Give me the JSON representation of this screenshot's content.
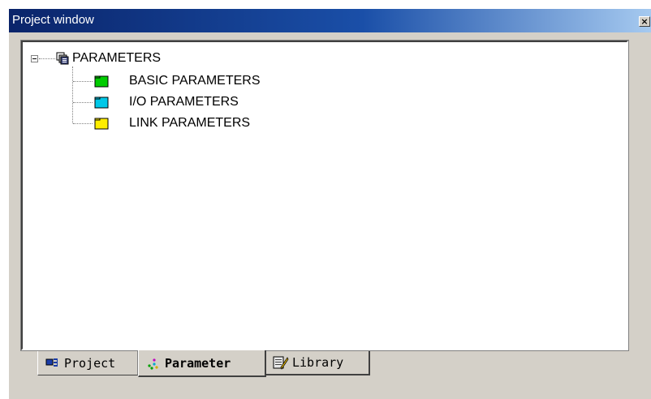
{
  "window": {
    "title": "Project window",
    "close_label": "×"
  },
  "tree": {
    "root": {
      "label": "PARAMETERS",
      "icon": "parameters-stack-icon",
      "expanded": true,
      "expander_symbol": "minus"
    },
    "children": [
      {
        "label": "BASIC PARAMETERS",
        "icon": "folder-icon",
        "color": "#00cc00"
      },
      {
        "label": "I/O PARAMETERS",
        "icon": "folder-icon",
        "color": "#00c8e8"
      },
      {
        "label": "LINK PARAMETERS",
        "icon": "folder-icon",
        "color": "#ffee00"
      }
    ]
  },
  "tabs": [
    {
      "label": "Project",
      "icon": "project-icon",
      "active": false
    },
    {
      "label": "Parameter",
      "icon": "parameter-icon",
      "active": true
    },
    {
      "label": "Library",
      "icon": "library-icon",
      "active": false
    }
  ],
  "colors": {
    "titlebar_start": "#0a246a",
    "titlebar_end": "#a6caf0",
    "face": "#d4d0c8"
  }
}
